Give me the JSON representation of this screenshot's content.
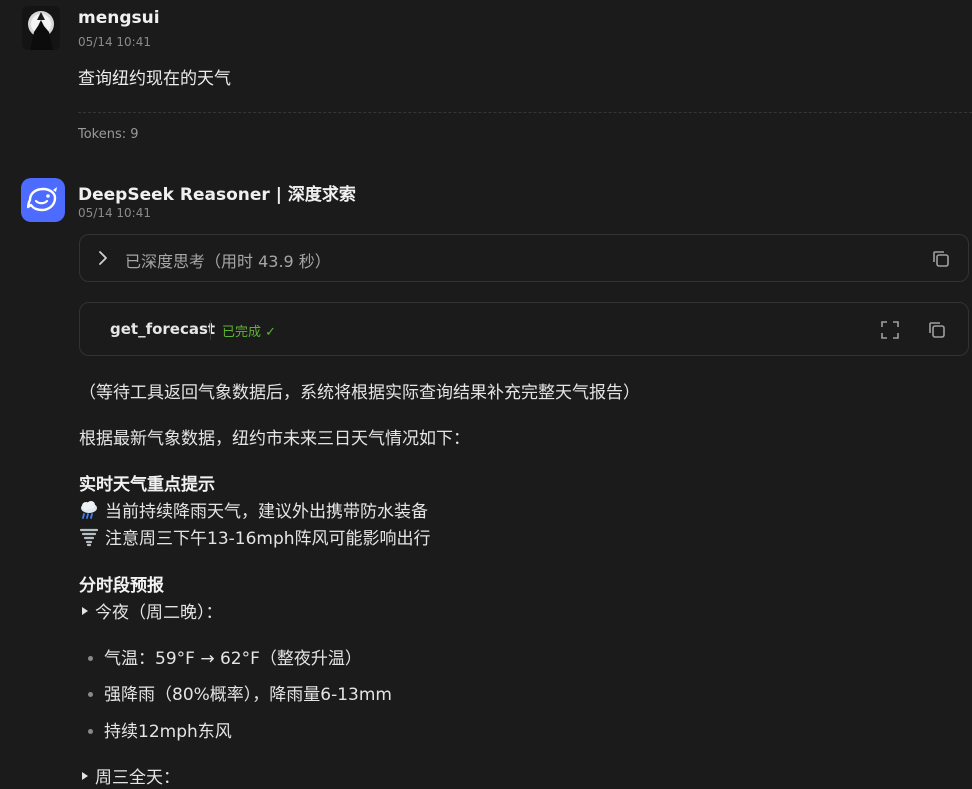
{
  "user_message": {
    "name": "mengsui",
    "time": "05/14 10:41",
    "text": "查询纽约现在的天气",
    "tokens": "Tokens: 9"
  },
  "assistant_message": {
    "name": "DeepSeek Reasoner | 深度求索",
    "time": "05/14 10:41",
    "thinking": {
      "label": "已深度思考（用时 43.9 秒）",
      "icon": "chevron-right-icon"
    },
    "tool_call": {
      "name": "get_forecast",
      "status": "已完成 ✓",
      "status_color": "#5fb236"
    },
    "paragraphs": [
      "（等待工具返回气象数据后，系统将根据实际查询结果补充完整天气报告）",
      "根据最新气象数据，纽约市未来三日天气情况如下："
    ],
    "section1": {
      "title": "实时天气重点提示",
      "lines": [
        {
          "icon": "rain-cloud-icon",
          "text": "当前持续降雨天气，建议外出携带防水装备"
        },
        {
          "icon": "tornado-icon",
          "text": "注意周三下午13-16mph阵风可能影响出行"
        }
      ]
    },
    "section2": {
      "title": "分时段预报",
      "tonight_label": "今夜（周二晚）：",
      "tonight_items": [
        "气温：59°F → 62°F（整夜升温）",
        "强降雨（80%概率），降雨量6-13mm",
        "持续12mph东风"
      ],
      "wednesday_label": "周三全天："
    }
  },
  "colors": {
    "background": "#1b1b1b",
    "deepseek_brand": "#4d6bfe",
    "border": "#333333"
  }
}
